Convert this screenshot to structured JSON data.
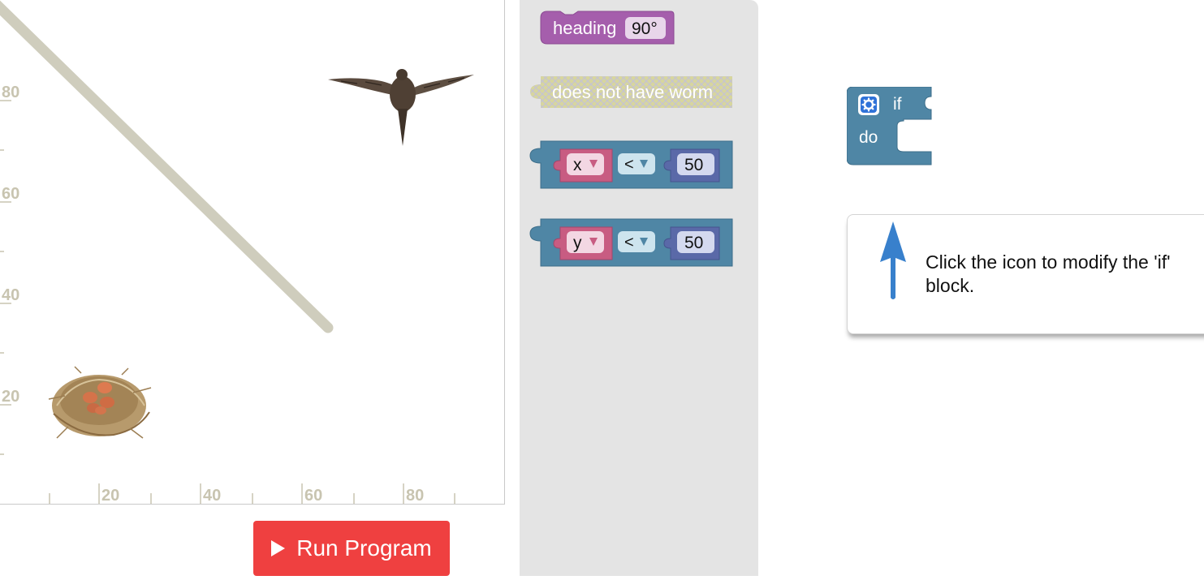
{
  "visualization": {
    "x_ticks": [
      "20",
      "40",
      "60",
      "80"
    ],
    "y_ticks": [
      "80",
      "60",
      "40",
      "20"
    ],
    "colors": {
      "path": "#cfcdbd",
      "tick": "#c8c4b0"
    }
  },
  "run_button": {
    "label": "Run Program",
    "icon": "play-icon",
    "color": "#ef4040"
  },
  "toolbox": {
    "blocks": [
      {
        "type": "heading",
        "label": "heading",
        "value": "90°",
        "color": "#a55eac"
      },
      {
        "type": "condition",
        "label": "does not have worm",
        "color": "#d8d49c"
      },
      {
        "type": "compare",
        "var": "x",
        "op": "<",
        "value": "50",
        "color": "#4f86a5"
      },
      {
        "type": "compare",
        "var": "y",
        "op": "<",
        "value": "50",
        "color": "#4f86a5"
      }
    ]
  },
  "workspace": {
    "if_block": {
      "gear_icon": "gear-icon",
      "if_label": "if",
      "do_label": "do",
      "color": "#4f86a5"
    },
    "hint": {
      "text": "Click the icon to modify the 'if' block.",
      "icon": "up-arrow-icon"
    }
  }
}
